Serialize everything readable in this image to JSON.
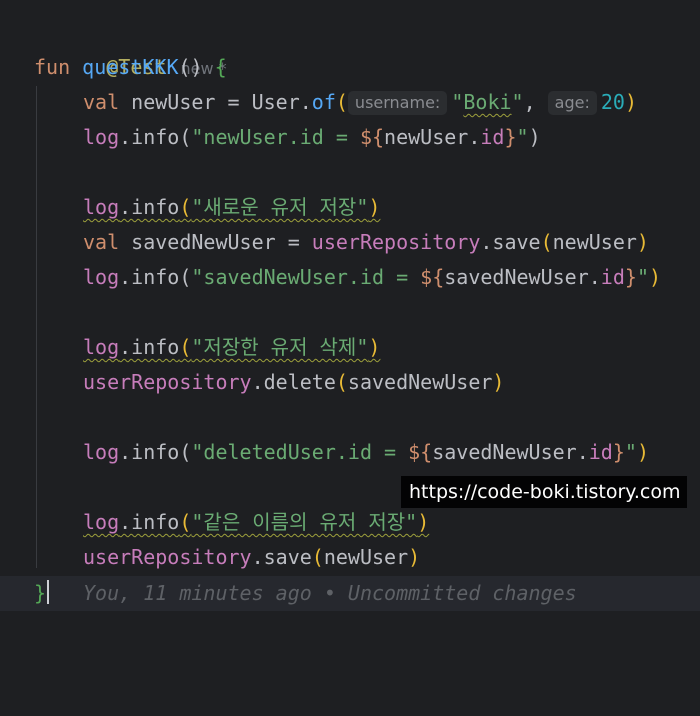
{
  "editor": {
    "annotation": "@Test",
    "annotation_meta": "new *",
    "fun_keyword": "fun",
    "function_name": "questKKK",
    "paren_pair": "()",
    "open_brace": "{",
    "close_brace": "}",
    "line1": {
      "val": "val",
      "var_name": " newUser = User.",
      "call": "of",
      "open_paren": "(",
      "hint1": "username:",
      "arg1": "\"Boki\"",
      "comma": ",",
      "hint2": "age:",
      "arg2": "20",
      "close_paren": ")"
    },
    "line2": {
      "log": "log",
      "dot_info": ".info(",
      "str_start": "\"newUser.id = ",
      "tpl_open": "${",
      "tpl_var": "newUser.",
      "tpl_prop": "id",
      "tpl_close": "}",
      "str_end": "\"",
      "close": ")"
    },
    "line3": {
      "log": "log",
      "info": ".info",
      "open": "(",
      "str": "\"새로운 유저 저장\"",
      "close": ")"
    },
    "line4": {
      "val": "val",
      "var_name": " savedNewUser = ",
      "repo": "userRepository",
      "call": ".save",
      "open": "(",
      "arg": "newUser",
      "close": ")"
    },
    "line5": {
      "log": "log",
      "dot_info": ".info(",
      "str_start": "\"savedNewUser.id = ",
      "tpl_open": "${",
      "tpl_var": "savedNewUser.",
      "tpl_prop": "id",
      "tpl_close": "}",
      "str_end": "\"",
      "close": ")"
    },
    "line6": {
      "log": "log",
      "info": ".info",
      "open": "(",
      "str": "\"저장한 유저 삭제\"",
      "close": ")"
    },
    "line7": {
      "repo": "userRepository",
      "call": ".delete",
      "open": "(",
      "arg": "savedNewUser",
      "close": ")"
    },
    "line8": {
      "log": "log",
      "dot_info": ".info(",
      "str_start": "\"deletedUser.id = ",
      "tpl_open": "${",
      "tpl_var": "savedNewUser.",
      "tpl_prop": "id",
      "tpl_close": "}",
      "str_end": "\"",
      "close": ")"
    },
    "line9": {
      "log": "log",
      "info": ".info",
      "open": "(",
      "str": "\"같은 이름의 유저 저장\"",
      "close": ")"
    },
    "line10": {
      "repo": "userRepository",
      "call": ".save",
      "open": "(",
      "arg": "newUser",
      "close": ")"
    },
    "blame": "You, 11 minutes ago • Uncommitted changes"
  },
  "watermark": "https://code-boki.tistory.com",
  "colors": {
    "background": "#1e1f22",
    "keyword": "#cf8e6d",
    "function": "#56a8f5",
    "property": "#c77dbb",
    "string": "#6aab73",
    "number": "#2aacb8",
    "annotation": "#b3ae60"
  }
}
